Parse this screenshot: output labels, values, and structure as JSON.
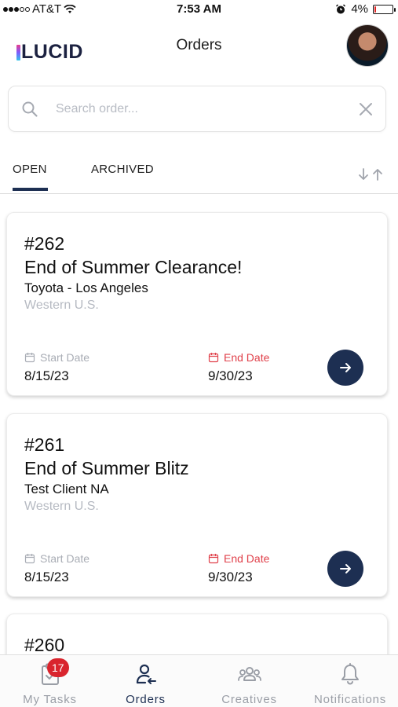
{
  "status_bar": {
    "carrier": "AT&T",
    "time": "7:53 AM",
    "battery": "4%",
    "battery_level": 0.04
  },
  "header": {
    "logo_text": "LUCID",
    "title": "Orders"
  },
  "search": {
    "placeholder": "Search order...",
    "value": ""
  },
  "tabs": [
    {
      "label": "OPEN",
      "active": true
    },
    {
      "label": "ARCHIVED",
      "active": false
    }
  ],
  "orders": [
    {
      "number": "#262",
      "title": "End of Summer Clearance!",
      "client": "Toyota - Los Angeles",
      "region": "Western U.S.",
      "start_label": "Start Date",
      "start_date": "8/15/23",
      "end_label": "End Date",
      "end_date": "9/30/23"
    },
    {
      "number": "#261",
      "title": "End of Summer Blitz",
      "client": "Test Client NA",
      "region": "Western U.S.",
      "start_label": "Start Date",
      "start_date": "8/15/23",
      "end_label": "End Date",
      "end_date": "9/30/23"
    },
    {
      "number": "#260"
    }
  ],
  "bottom_nav": [
    {
      "label": "My Tasks",
      "icon": "clipboard-check-icon",
      "badge": "17"
    },
    {
      "label": "Orders",
      "icon": "user-orders-icon",
      "active": true
    },
    {
      "label": "Creatives",
      "icon": "group-icon"
    },
    {
      "label": "Notifications",
      "icon": "bell-icon"
    }
  ],
  "colors": {
    "accent": "#1d2f52",
    "end_date": "#e0404a",
    "badge": "#d9252e",
    "muted": "#b6bac2"
  }
}
